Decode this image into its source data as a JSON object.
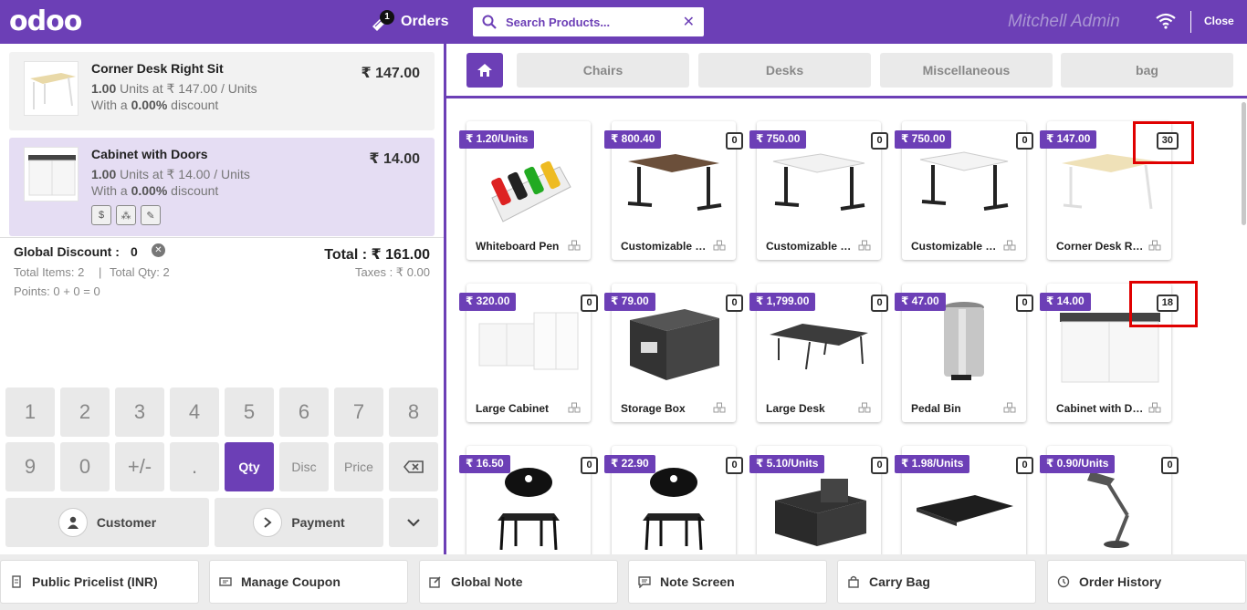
{
  "header": {
    "logo": "odoo",
    "orders_label": "Orders",
    "orders_count": "1",
    "search_placeholder": "Search Products...",
    "user": "Mitchell Admin",
    "close_label": "Close"
  },
  "order": {
    "lines": [
      {
        "name": "Corner Desk Right Sit",
        "price": "₹ 147.00",
        "qty": "1.00",
        "unit_text": " Units at ₹ 147.00 / Units",
        "disc_prefix": "With a ",
        "discount": "0.00%",
        "disc_suffix": " discount"
      },
      {
        "name": "Cabinet with Doors",
        "price": "₹ 14.00",
        "qty": "1.00",
        "unit_text": " Units at ₹ 14.00 / Units",
        "disc_prefix": "With a ",
        "discount": "0.00%",
        "disc_suffix": " discount"
      }
    ],
    "global_discount_label": "Global Discount :",
    "global_discount_value": "0",
    "total": "Total : ₹ 161.00",
    "total_items": "Total Items: 2",
    "separator": "|",
    "total_qty": "Total Qty: 2",
    "taxes": "Taxes : ₹ 0.00",
    "points": "Points: 0 + 0 = 0"
  },
  "numpad": {
    "keys": [
      "1",
      "2",
      "3",
      "4",
      "5",
      "6",
      "7",
      "8",
      "9",
      "0",
      "+/-",
      "."
    ],
    "modes": [
      "Qty",
      "Disc",
      "Price"
    ],
    "customer": "Customer",
    "payment": "Payment"
  },
  "categories": [
    "Chairs",
    "Desks",
    "Miscellaneous",
    "bag"
  ],
  "products": [
    {
      "name": "Whiteboard Pen",
      "price": "₹ 1.20/Units",
      "qty": ""
    },
    {
      "name": "Customizable Desk",
      "price": "₹ 800.40",
      "qty": "0"
    },
    {
      "name": "Customizable Desk",
      "price": "₹ 750.00",
      "qty": "0"
    },
    {
      "name": "Customizable Desk",
      "price": "₹ 750.00",
      "qty": "0"
    },
    {
      "name": "Corner Desk Right Sit",
      "price": "₹ 147.00",
      "qty": "30"
    },
    {
      "name": "Large Cabinet",
      "price": "₹ 320.00",
      "qty": "0"
    },
    {
      "name": "Storage Box",
      "price": "₹ 79.00",
      "qty": "0"
    },
    {
      "name": "Large Desk",
      "price": "₹ 1,799.00",
      "qty": "0"
    },
    {
      "name": "Pedal Bin",
      "price": "₹ 47.00",
      "qty": "0"
    },
    {
      "name": "Cabinet with Doors",
      "price": "₹ 14.00",
      "qty": "18"
    },
    {
      "name": "",
      "price": "₹ 16.50",
      "qty": "0"
    },
    {
      "name": "",
      "price": "₹ 22.90",
      "qty": "0"
    },
    {
      "name": "",
      "price": "₹ 5.10/Units",
      "qty": "0"
    },
    {
      "name": "",
      "price": "₹ 1.98/Units",
      "qty": "0"
    },
    {
      "name": "",
      "price": "₹ 0.90/Units",
      "qty": "0"
    }
  ],
  "footer": {
    "buttons": [
      "Public Pricelist (INR)",
      "Manage Coupon",
      "Global Note",
      "Note Screen",
      "Carry Bag",
      "Order History"
    ]
  },
  "colors": {
    "brand": "#6c3fb6",
    "highlight": "#e00000"
  }
}
